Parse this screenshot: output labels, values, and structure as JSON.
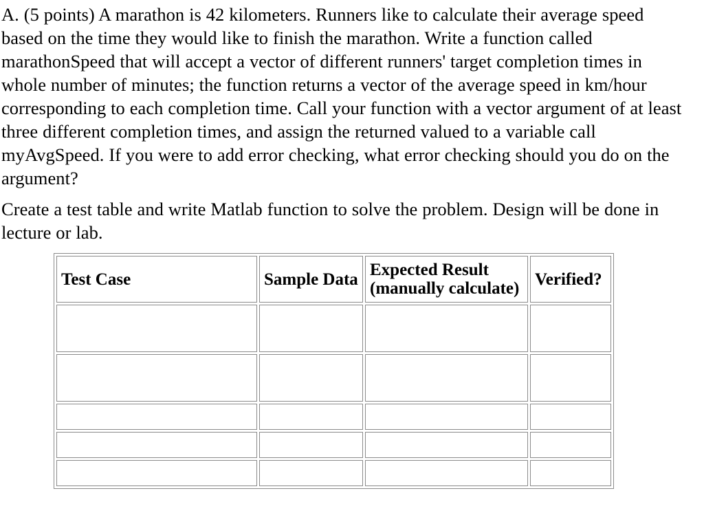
{
  "document": {
    "paragraphs": [
      "A. (5 points) A marathon is 42 kilometers. Runners like to calculate their average speed based on the time they would like to finish the marathon. Write a function called marathonSpeed that will accept a vector of different runners' target completion times in whole number of minutes; the function returns a vector of the average speed in km/hour corresponding to each completion time. Call your function with a vector argument of at least three different completion times, and assign the returned valued to a variable call myAvgSpeed. If you were to add error checking, what error checking should you do on the argument?",
      "Create a test table and write Matlab function to solve the problem. Design will be done in lecture or lab."
    ]
  },
  "test_table": {
    "headers": {
      "test_case": "Test Case",
      "sample_data": "Sample Data",
      "expected_result_line1": "Expected Result",
      "expected_result_line2": "(manually calculate)",
      "verified": "Verified?"
    },
    "rows": [
      {
        "test_case": "",
        "sample_data": "",
        "expected_result": "",
        "verified": ""
      },
      {
        "test_case": "",
        "sample_data": "",
        "expected_result": "",
        "verified": ""
      },
      {
        "test_case": "",
        "sample_data": "",
        "expected_result": "",
        "verified": ""
      },
      {
        "test_case": "",
        "sample_data": "",
        "expected_result": "",
        "verified": ""
      },
      {
        "test_case": "",
        "sample_data": "",
        "expected_result": "",
        "verified": ""
      }
    ]
  },
  "style": {
    "border_color": "#8a8a8a",
    "text_color": "#000000",
    "background": "#ffffff"
  }
}
